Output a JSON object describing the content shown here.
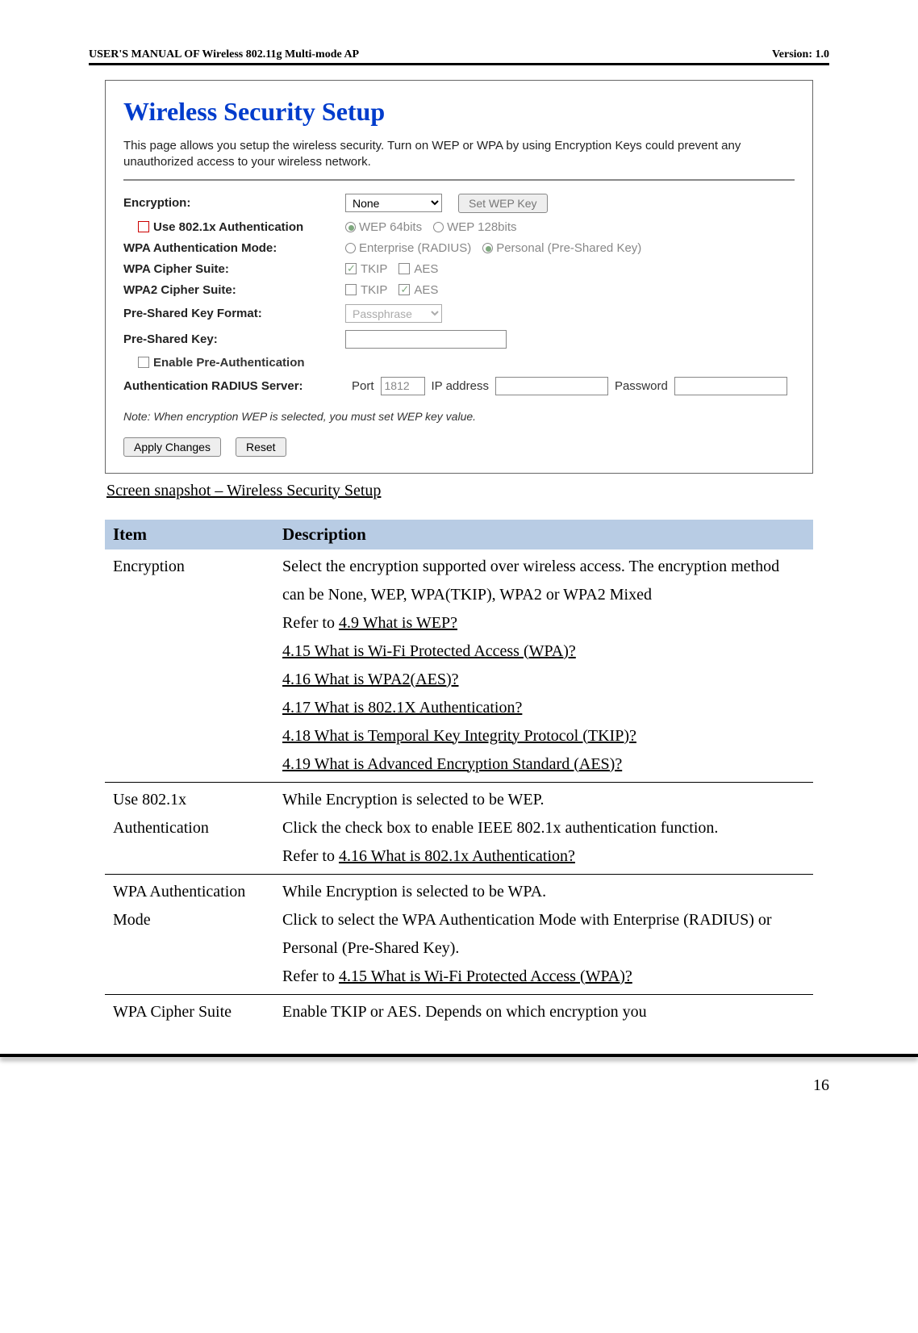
{
  "header": {
    "left": "USER'S MANUAL OF Wireless 802.11g Multi-mode AP",
    "right": "Version: 1.0"
  },
  "panel": {
    "title": "Wireless Security Setup",
    "desc": "This page allows you setup the wireless security. Turn on WEP or WPA by using Encryption Keys could prevent any unauthorized access to your wireless network.",
    "encryption_label": "Encryption:",
    "encryption_value": "None",
    "set_wep_btn": "Set WEP Key",
    "use8021x_label": "Use 802.1x Authentication",
    "wep64": "WEP 64bits",
    "wep128": "WEP 128bits",
    "wpa_auth_mode_label": "WPA Authentication Mode:",
    "enterprise": "Enterprise (RADIUS)",
    "personal": "Personal (Pre-Shared Key)",
    "wpa_cipher_label": "WPA Cipher Suite:",
    "wpa2_cipher_label": "WPA2 Cipher Suite:",
    "tkip": "TKIP",
    "aes": "AES",
    "pskf_label": "Pre-Shared Key Format:",
    "pskf_value": "Passphrase",
    "psk_label": "Pre-Shared Key:",
    "preauth_label": "Enable Pre-Authentication",
    "radius_label": "Authentication RADIUS Server:",
    "port_label": "Port",
    "port_value": "1812",
    "ip_label": "IP address",
    "pw_label": "Password",
    "note": "Note: When encryption WEP is selected, you must set WEP key value.",
    "apply_btn": "Apply Changes",
    "reset_btn": "Reset"
  },
  "caption": "Screen snapshot – Wireless Security Setup",
  "table": {
    "h1": "Item",
    "h2": "Description",
    "rows": [
      {
        "item": "Encryption",
        "lines": [
          {
            "t": "Select the encryption supported over wireless access. The encryption method can be None, WEP, WPA(TKIP), WPA2 or WPA2 Mixed"
          },
          {
            "pre": "Refer to ",
            "link": "4.9 What is WEP?"
          },
          {
            "link": "4.15 What is Wi-Fi Protected Access (WPA)?"
          },
          {
            "link": "4.16 What is WPA2(AES)?"
          },
          {
            "link": "4.17 What is 802.1X Authentication?"
          },
          {
            "link": "4.18 What is Temporal Key Integrity Protocol (TKIP)?"
          },
          {
            "link": "4.19 What is Advanced Encryption Standard (AES)?"
          }
        ]
      },
      {
        "item": "Use 802.1x Authentication",
        "lines": [
          {
            "t": "While Encryption is selected to be WEP."
          },
          {
            "t": "Click the check box to enable IEEE 802.1x authentication function."
          },
          {
            "pre": "Refer to ",
            "link": "4.16 What is 802.1x Authentication?"
          }
        ]
      },
      {
        "item": "WPA Authentication Mode",
        "lines": [
          {
            "t": "While Encryption is selected to be WPA."
          },
          {
            "t": "Click to select the WPA Authentication Mode with Enterprise (RADIUS) or Personal (Pre-Shared Key)."
          },
          {
            "pre": "Refer to ",
            "link": "4.15 What is Wi-Fi Protected Access (WPA)?"
          }
        ]
      },
      {
        "item": "WPA Cipher Suite",
        "lines": [
          {
            "t": "Enable TKIP or AES. Depends on which encryption you"
          }
        ],
        "open": true
      }
    ]
  },
  "page_number": "16"
}
